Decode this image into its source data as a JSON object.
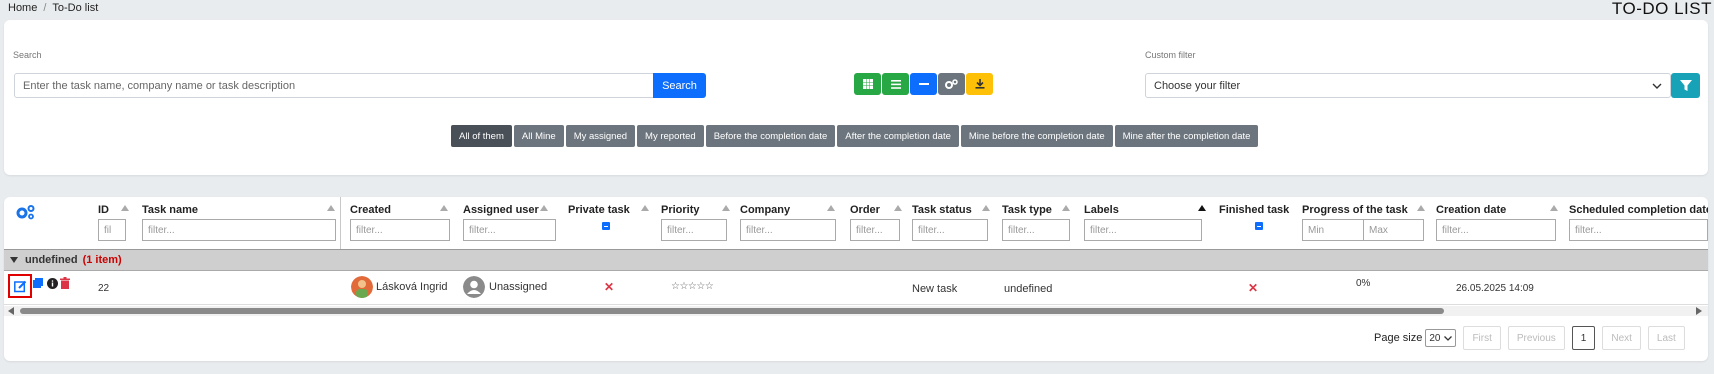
{
  "breadcrumb": {
    "home": "Home",
    "separator": "/",
    "current": "To-Do list"
  },
  "page_title": "TO-DO LIST",
  "search": {
    "label": "Search",
    "placeholder": "Enter the task name, company name or task description",
    "button": "Search"
  },
  "view_buttons": [
    {
      "icon": "grid-icon",
      "color": "#28a745"
    },
    {
      "icon": "list-icon",
      "color": "#28a745"
    },
    {
      "icon": "minus-icon",
      "color": "#0d6efd"
    },
    {
      "icon": "settings-icon",
      "color": "#6c757d"
    },
    {
      "icon": "download-icon",
      "color": "#ffc107"
    }
  ],
  "custom_filter": {
    "label": "Custom filter",
    "placeholder": "Choose your filter",
    "button_icon": "funnel-icon",
    "button_color": "#17a2b8"
  },
  "quick_filters": [
    "All of them",
    "All Mine",
    "My assigned",
    "My reported",
    "Before the completion date",
    "After the completion date",
    "Mine before the completion date",
    "Mine after the completion date"
  ],
  "table": {
    "columns": {
      "id": "ID",
      "task_name": "Task name",
      "created": "Created",
      "assigned_user": "Assigned user",
      "private_task": "Private task",
      "priority": "Priority",
      "company": "Company",
      "order": "Order",
      "task_status": "Task status",
      "task_type": "Task type",
      "labels": "Labels",
      "finished_task": "Finished task",
      "progress": "Progress of the task",
      "creation_date": "Creation date",
      "scheduled_completion": "Scheduled completion date"
    },
    "filters": {
      "id": "fil",
      "text": "filter...",
      "min": "Min",
      "max": "Max"
    },
    "group": {
      "name": "undefined",
      "count": "(1 item)"
    },
    "row": {
      "id": "22",
      "created": "Lásková Ingrid",
      "assigned_user": "Unassigned",
      "private_task": "✕",
      "priority": "☆☆☆☆☆",
      "task_status": "New task",
      "task_type": "undefined",
      "finished_task": "✕",
      "progress": "0%",
      "creation_date": "26.05.2025 14:09"
    }
  },
  "pagination": {
    "page_size_label": "Page size",
    "page_size": "20",
    "first": "First",
    "previous": "Previous",
    "current": "1",
    "next": "Next",
    "last": "Last"
  },
  "colors": {
    "accent": "#0d6efd",
    "danger": "#dc3545",
    "group_count": "#cc0000"
  }
}
